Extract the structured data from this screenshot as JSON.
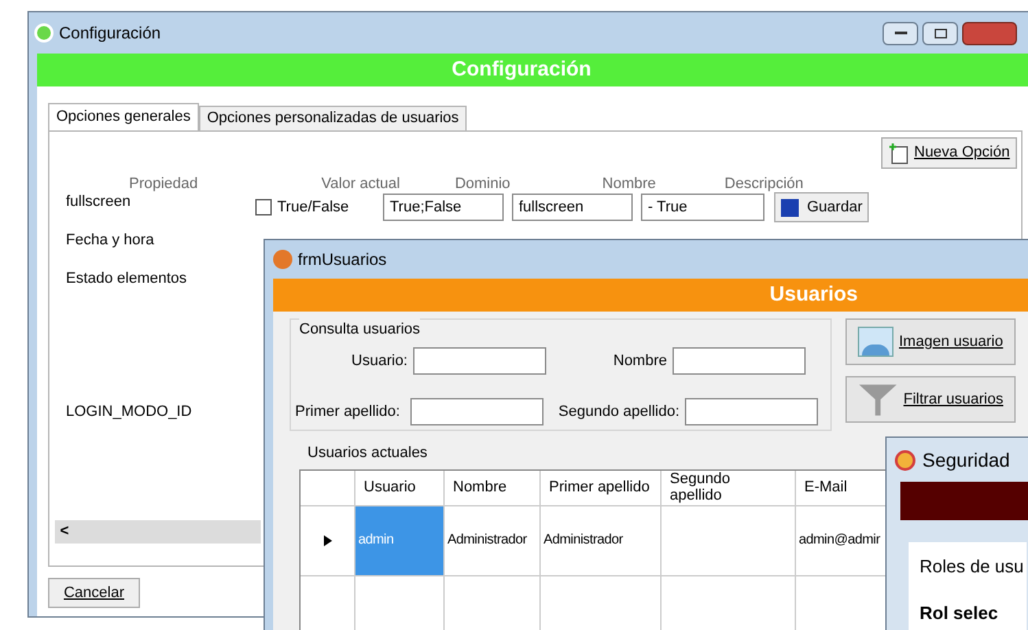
{
  "config_window": {
    "title": "Configuración",
    "banner": "Configuración",
    "tabs": [
      {
        "label": "Opciones generales",
        "selected": true
      },
      {
        "label": "Opciones personalizadas de usuarios",
        "selected": false
      }
    ],
    "new_option_button": "Nueva Opción",
    "columns": [
      "Propiedad",
      "Valor actual",
      "Dominio",
      "Nombre",
      "Descripción"
    ],
    "editing": {
      "property": "fullscreen",
      "checked": false,
      "value_label": "True/False",
      "domain": "True;False",
      "name": "fullscreen",
      "description": "- True",
      "save_button": "Guardar"
    },
    "properties": [
      "Fecha y hora",
      "Estado elementos",
      "LOGIN_MODO_ID"
    ],
    "scroll_left": "<",
    "cancel_button": "Cancelar"
  },
  "users_window": {
    "title": "frmUsuarios",
    "banner": "Usuarios",
    "query_group": {
      "title": "Consulta usuarios",
      "fields": [
        {
          "label": "Usuario:"
        },
        {
          "label": "Nombre"
        },
        {
          "label": "Primer apellido:"
        },
        {
          "label": "Segundo apellido:"
        }
      ]
    },
    "buttons": [
      "Imagen usuario",
      "Filtrar usuarios"
    ],
    "grid_title": "Usuarios actuales",
    "columns": [
      "Usuario",
      "Nombre",
      "Primer apellido",
      "Segundo apellido",
      "E-Mail"
    ],
    "rows": [
      {
        "current": true,
        "cells": [
          {
            "text": "admin",
            "selected": true
          },
          {
            "text": "Administrador",
            "selected": false
          },
          {
            "text": "Administrador",
            "selected": false
          },
          {
            "text": "",
            "selected": false
          },
          {
            "text": "admin@admir",
            "selected": false
          }
        ]
      },
      {
        "current": false,
        "cells": [
          {
            "text": "",
            "selected": false
          },
          {
            "text": "",
            "selected": false
          },
          {
            "text": "",
            "selected": false
          },
          {
            "text": "",
            "selected": false
          },
          {
            "text": "",
            "selected": false
          }
        ]
      }
    ]
  },
  "security_window": {
    "title": "Seguridad",
    "roles_label": "Roles de usu",
    "selected_role_label": "Rol selec"
  }
}
